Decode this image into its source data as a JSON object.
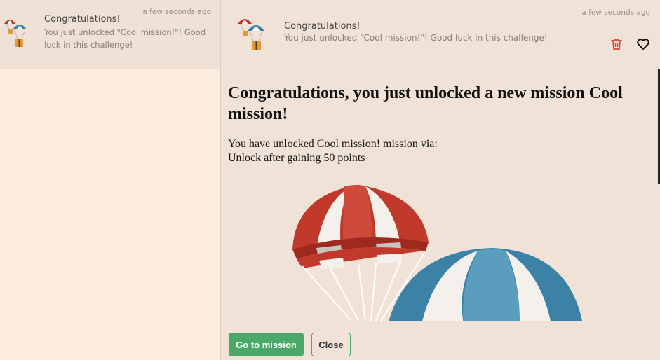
{
  "list": {
    "items": [
      {
        "title": "Congratulations!",
        "message": "You just unlocked \"Cool mission!\"! Good luck in this challenge!",
        "time": "a few seconds ago"
      }
    ]
  },
  "detail": {
    "title": "Congratulations!",
    "message": "You just unlocked \"Cool mission!\"! Good luck in this challenge!",
    "time": "a few seconds ago",
    "heading": "Congratulations, you just unlocked a new mission Cool mission!",
    "body_line1": "You have unlocked Cool mission! mission via:",
    "body_line2": "Unlock after gaining 50 points",
    "go_button": "Go to mission",
    "close_button": "Close",
    "icons": {
      "delete": "trash-icon",
      "favorite": "heart-icon"
    }
  },
  "colors": {
    "primary": "#4aa96a",
    "delete": "#d9453a",
    "parachute_red": "#c0392b",
    "parachute_blue": "#3c82a6"
  }
}
